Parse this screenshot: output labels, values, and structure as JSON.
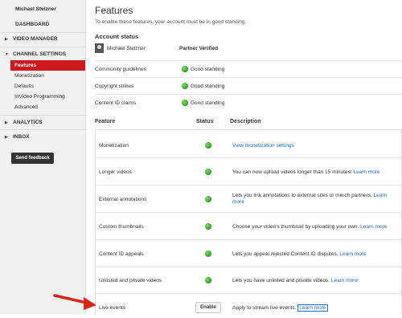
{
  "sidebar": {
    "user_name": "Michael Stelzner",
    "dashboard": "DASHBOARD",
    "video_manager": "VIDEO MANAGER",
    "channel_settings": "CHANNEL SETTINGS",
    "items": [
      "Features",
      "Monetization",
      "Defaults",
      "InVideo Programming",
      "Advanced"
    ],
    "analytics": "ANALYTICS",
    "inbox": "INBOX",
    "send_feedback": "Send feedback"
  },
  "page": {
    "title": "Features",
    "subtitle": "To enable these features, your account must be in good standing."
  },
  "account_status": {
    "heading": "Account status",
    "name": "Michael Stelzner",
    "verified": "Partner Verified",
    "rows": [
      {
        "label": "Community guidelines",
        "value": "Good standing"
      },
      {
        "label": "Copyright strikes",
        "value": "Good standing"
      },
      {
        "label": "Content ID claims",
        "value": "Good standing"
      }
    ]
  },
  "features_table": {
    "headers": {
      "feature": "Feature",
      "status": "Status",
      "description": "Description"
    },
    "rows": [
      {
        "name": "Monetization",
        "text": "",
        "link": "View monetization settings"
      },
      {
        "name": "Longer videos",
        "text": "You can now upload videos longer than 15 minutes! ",
        "link": "Learn more"
      },
      {
        "name": "External annotations",
        "text": "Lets you link annotations to external sites or merch partners. ",
        "link": "Learn more"
      },
      {
        "name": "Custom thumbnails",
        "text": "Choose your video's thumbnail by uploading your own. ",
        "link": "Learn more"
      },
      {
        "name": "Content ID appeals",
        "text": "Lets you appeal rejected Content ID disputes. ",
        "link": "Learn more"
      },
      {
        "name": "Unlisted and private videos",
        "text": "Lets you have unlisted and private videos. ",
        "link": "Learn more"
      },
      {
        "name": "Live events",
        "button": "Enable",
        "text": "Apply to stream live events. ",
        "link": "Learn more"
      }
    ]
  },
  "colors": {
    "accent": "#cc181e",
    "status_good": "#3fae2a",
    "link": "#1a6dcf"
  }
}
